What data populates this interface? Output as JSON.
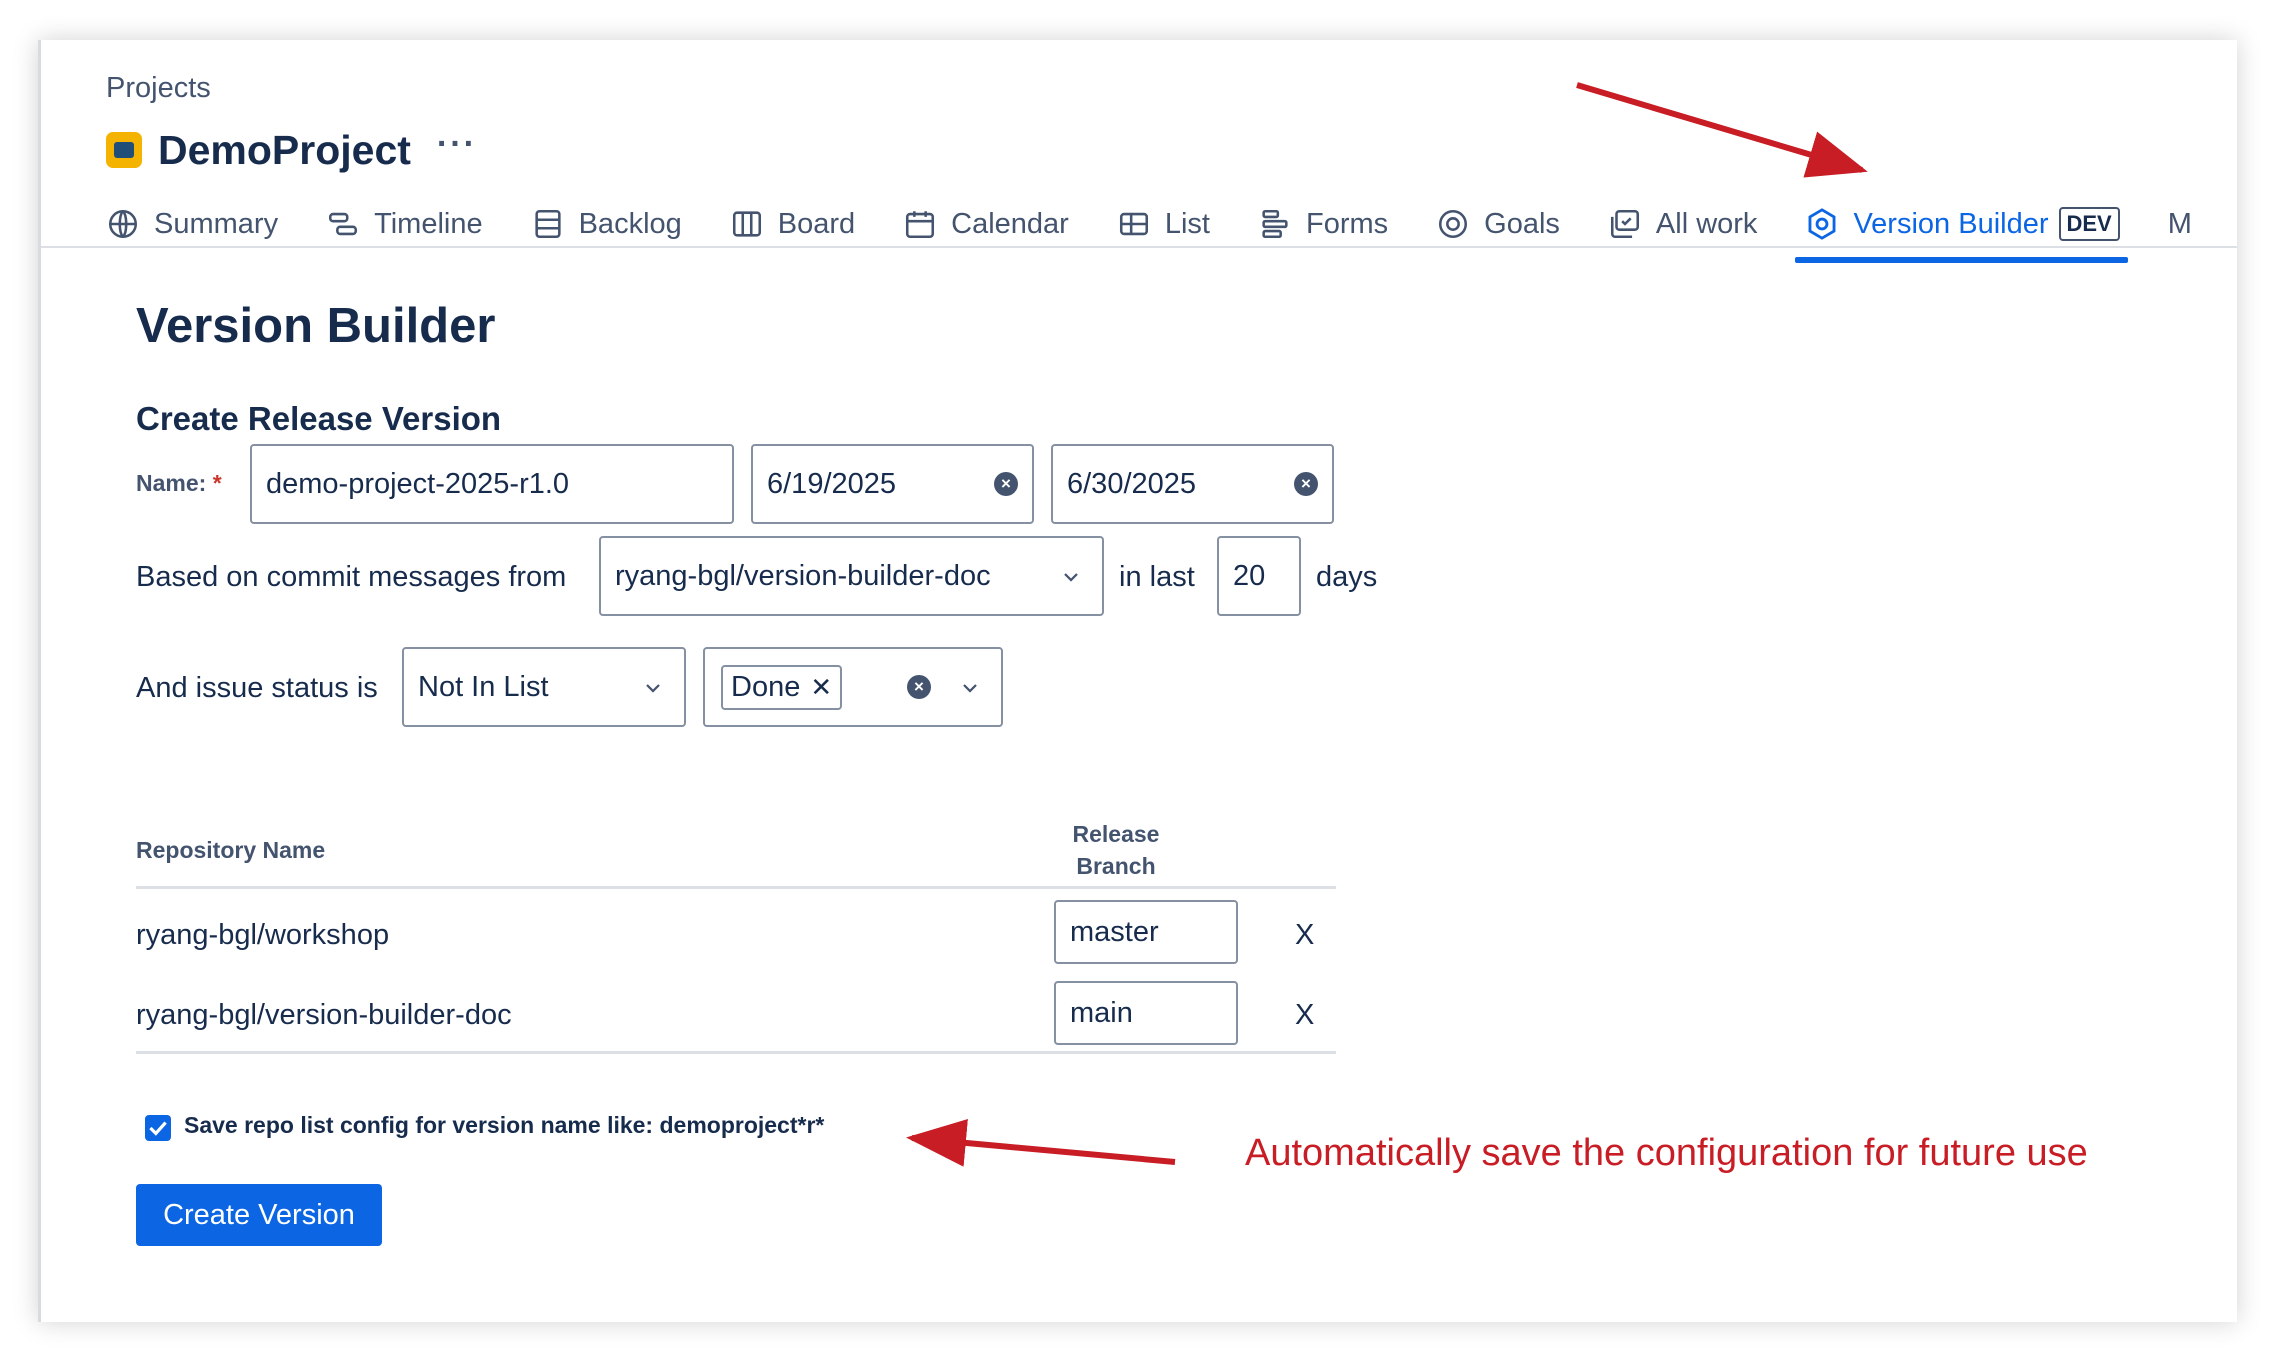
{
  "breadcrumb": "Projects",
  "project": {
    "name": "DemoProject",
    "more": "···"
  },
  "tabs": [
    {
      "label": "Summary",
      "icon": "globe-icon"
    },
    {
      "label": "Timeline",
      "icon": "timeline-icon"
    },
    {
      "label": "Backlog",
      "icon": "backlog-icon"
    },
    {
      "label": "Board",
      "icon": "board-icon"
    },
    {
      "label": "Calendar",
      "icon": "calendar-icon"
    },
    {
      "label": "List",
      "icon": "list-icon"
    },
    {
      "label": "Forms",
      "icon": "forms-icon"
    },
    {
      "label": "Goals",
      "icon": "goals-icon"
    },
    {
      "label": "All work",
      "icon": "all-work-icon"
    },
    {
      "label": "Version Builder",
      "icon": "version-builder-icon",
      "badge": "DEV",
      "active": true
    },
    {
      "label": "M",
      "icon": ""
    }
  ],
  "page": {
    "title": "Version Builder",
    "section_title": "Create Release Version"
  },
  "form": {
    "name_label": "Name:",
    "required_mark": "*",
    "name_value": "demo-project-2025-r1.0",
    "start_date": "6/19/2025",
    "end_date": "6/30/2025",
    "commit_label": "Based on commit messages from",
    "repo_select": "ryang-bgl/version-builder-doc",
    "in_last_label": "in last",
    "days_value": "20",
    "days_label": "days",
    "status_label": "And issue status is",
    "status_operator": "Not In List",
    "status_chip": "Done"
  },
  "table": {
    "headers": {
      "repo": "Repository Name",
      "branch_line1": "Release",
      "branch_line2": "Branch"
    },
    "rows": [
      {
        "repo": "ryang-bgl/workshop",
        "branch": "master",
        "remove": "X"
      },
      {
        "repo": "ryang-bgl/version-builder-doc",
        "branch": "main",
        "remove": "X"
      }
    ]
  },
  "save_config": {
    "checked": true,
    "label": "Save repo list config for version name like: demoproject*r*"
  },
  "create_button": "Create Version",
  "annotation": "Automatically save the configuration for future use",
  "colors": {
    "accent": "#0c66e4",
    "annotation": "#c81d25",
    "text": "#172b4d"
  }
}
